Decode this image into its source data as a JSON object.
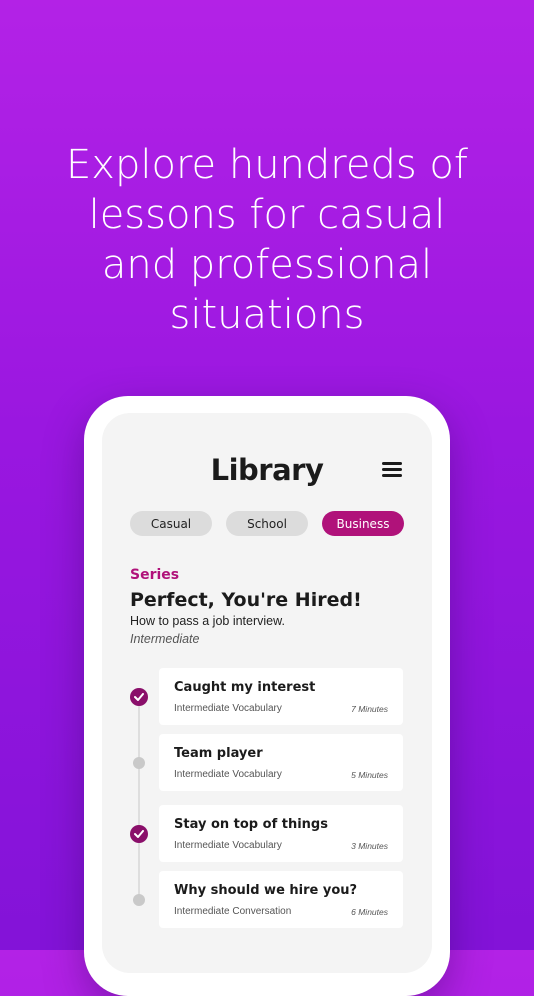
{
  "headline": "Explore hundreds of\nlessons for casual\nand professional\nsituations",
  "library": {
    "title": "Library",
    "tabs": [
      {
        "label": "Casual",
        "active": false
      },
      {
        "label": "School",
        "active": false
      },
      {
        "label": "Business",
        "active": true
      }
    ],
    "series": {
      "label": "Series",
      "title": "Perfect, You're Hired!",
      "description": "How to pass a job interview.",
      "level": "Intermediate"
    },
    "lessons": [
      {
        "name": "Caught my interest",
        "category": "Intermediate Vocabulary",
        "duration": "7 Minutes",
        "completed": true
      },
      {
        "name": "Team player",
        "category": "Intermediate Vocabulary",
        "duration": "5 Minutes",
        "completed": false
      },
      {
        "name": "Stay on top of things",
        "category": "Intermediate Vocabulary",
        "duration": "3 Minutes",
        "completed": true
      },
      {
        "name": "Why should we hire you?",
        "category": "Intermediate Conversation",
        "duration": "6 Minutes",
        "completed": false
      }
    ]
  },
  "colors": {
    "accent": "#b0127a",
    "completed_marker": "#8a0f6a",
    "background_top": "#b322e6",
    "background_bottom": "#8313d8"
  }
}
